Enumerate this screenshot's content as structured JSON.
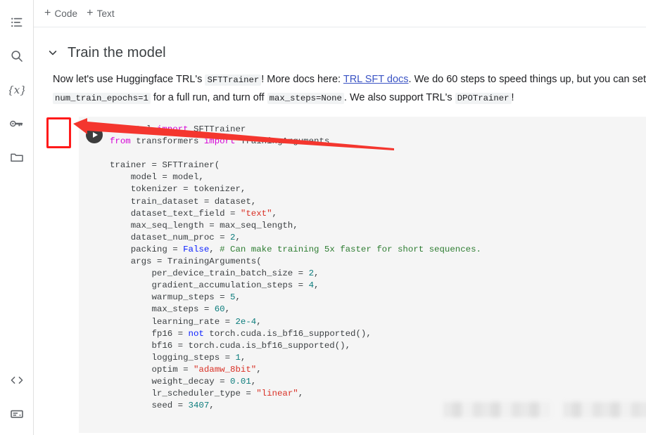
{
  "rail": {
    "top_items": [
      {
        "name": "table-of-contents-icon",
        "label": "Table of contents"
      },
      {
        "name": "search-icon",
        "label": "Find and replace"
      },
      {
        "name": "variables-icon",
        "label": "Variables"
      },
      {
        "name": "key-icon",
        "label": "Secrets"
      },
      {
        "name": "folder-icon",
        "label": "Files"
      }
    ],
    "bottom_items": [
      {
        "name": "code-snippets-icon",
        "label": "Code snippets"
      },
      {
        "name": "terminal-icon",
        "label": "Terminal"
      }
    ]
  },
  "toolbar": {
    "add_code_label": "Code",
    "add_text_label": "Text",
    "plus_glyph": "+"
  },
  "section": {
    "title": "Train the model",
    "chevron_glyph": "⌄",
    "expanded": true
  },
  "paragraph": {
    "part1": "Now let's use Huggingface TRL's ",
    "code1": "SFTTrainer",
    "part2": "! More docs here: ",
    "link_text": "TRL SFT docs",
    "part3": ". We do 60 steps to speed things up, but you can set ",
    "code2": "num_train_epochs=1",
    "part4": " for a full run, and turn off ",
    "code3": "max_steps=None",
    "part5": ". We also support TRL's ",
    "code4": "DPOTrainer",
    "part6": "!"
  },
  "code_cell": {
    "run_button_label": "Run cell",
    "lines": [
      [
        {
          "t": "from ",
          "c": "kw"
        },
        {
          "t": "trl ",
          "c": "pln"
        },
        {
          "t": "import ",
          "c": "kw"
        },
        {
          "t": "SFTTrainer",
          "c": "pln"
        }
      ],
      [
        {
          "t": "from ",
          "c": "kw"
        },
        {
          "t": "transformers ",
          "c": "pln"
        },
        {
          "t": "import ",
          "c": "kw"
        },
        {
          "t": "TrainingArguments",
          "c": "pln"
        }
      ],
      [
        {
          "t": "",
          "c": "pln"
        }
      ],
      [
        {
          "t": "trainer = SFTTrainer(",
          "c": "pln"
        }
      ],
      [
        {
          "t": "    model = model,",
          "c": "pln"
        }
      ],
      [
        {
          "t": "    tokenizer = tokenizer,",
          "c": "pln"
        }
      ],
      [
        {
          "t": "    train_dataset = dataset,",
          "c": "pln"
        }
      ],
      [
        {
          "t": "    dataset_text_field = ",
          "c": "pln"
        },
        {
          "t": "\"text\"",
          "c": "str"
        },
        {
          "t": ",",
          "c": "pln"
        }
      ],
      [
        {
          "t": "    max_seq_length = max_seq_length,",
          "c": "pln"
        }
      ],
      [
        {
          "t": "    dataset_num_proc = ",
          "c": "pln"
        },
        {
          "t": "2",
          "c": "num"
        },
        {
          "t": ",",
          "c": "pln"
        }
      ],
      [
        {
          "t": "    packing = ",
          "c": "pln"
        },
        {
          "t": "False",
          "c": "bul"
        },
        {
          "t": ", ",
          "c": "pln"
        },
        {
          "t": "# Can make training 5x faster for short sequences.",
          "c": "cmt"
        }
      ],
      [
        {
          "t": "    args = TrainingArguments(",
          "c": "pln"
        }
      ],
      [
        {
          "t": "        per_device_train_batch_size = ",
          "c": "pln"
        },
        {
          "t": "2",
          "c": "num"
        },
        {
          "t": ",",
          "c": "pln"
        }
      ],
      [
        {
          "t": "        gradient_accumulation_steps = ",
          "c": "pln"
        },
        {
          "t": "4",
          "c": "num"
        },
        {
          "t": ",",
          "c": "pln"
        }
      ],
      [
        {
          "t": "        warmup_steps = ",
          "c": "pln"
        },
        {
          "t": "5",
          "c": "num"
        },
        {
          "t": ",",
          "c": "pln"
        }
      ],
      [
        {
          "t": "        max_steps = ",
          "c": "pln"
        },
        {
          "t": "60",
          "c": "num"
        },
        {
          "t": ",",
          "c": "pln"
        }
      ],
      [
        {
          "t": "        learning_rate = ",
          "c": "pln"
        },
        {
          "t": "2e-4",
          "c": "num"
        },
        {
          "t": ",",
          "c": "pln"
        }
      ],
      [
        {
          "t": "        fp16 = ",
          "c": "pln"
        },
        {
          "t": "not ",
          "c": "bul"
        },
        {
          "t": "torch.cuda.is_bf16_supported(),",
          "c": "pln"
        }
      ],
      [
        {
          "t": "        bf16 = torch.cuda.is_bf16_supported(),",
          "c": "pln"
        }
      ],
      [
        {
          "t": "        logging_steps = ",
          "c": "pln"
        },
        {
          "t": "1",
          "c": "num"
        },
        {
          "t": ",",
          "c": "pln"
        }
      ],
      [
        {
          "t": "        optim = ",
          "c": "pln"
        },
        {
          "t": "\"adamw_8bit\"",
          "c": "str"
        },
        {
          "t": ",",
          "c": "pln"
        }
      ],
      [
        {
          "t": "        weight_decay = ",
          "c": "pln"
        },
        {
          "t": "0.01",
          "c": "num"
        },
        {
          "t": ",",
          "c": "pln"
        }
      ],
      [
        {
          "t": "        lr_scheduler_type = ",
          "c": "pln"
        },
        {
          "t": "\"linear\"",
          "c": "str"
        },
        {
          "t": ",",
          "c": "pln"
        }
      ],
      [
        {
          "t": "        seed = ",
          "c": "pln"
        },
        {
          "t": "3407",
          "c": "num"
        },
        {
          "t": ",",
          "c": "pln"
        }
      ]
    ]
  },
  "annotation": {
    "highlight_color": "#ff1a1a",
    "arrow_color": "#f4362e",
    "target": "run-cell-button"
  }
}
